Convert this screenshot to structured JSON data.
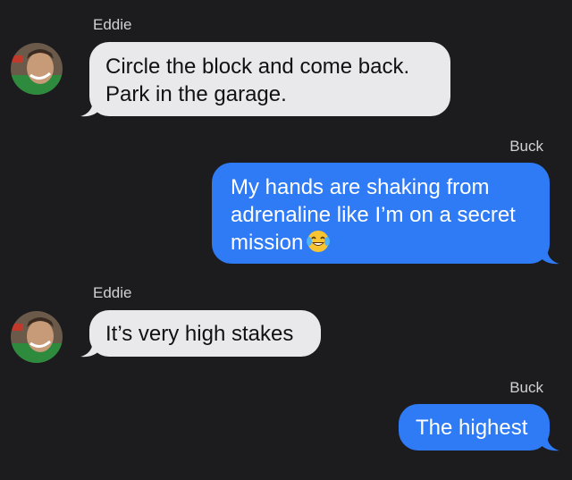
{
  "messages": [
    {
      "sender": "Eddie",
      "direction": "incoming",
      "lines": [
        "Circle the block and come back.",
        "Park in the garage."
      ]
    },
    {
      "sender": "Buck",
      "direction": "outgoing",
      "lines": [
        "My hands are shaking from",
        "adrenaline like I’m on a secret",
        "mission"
      ],
      "emoji": "tears-of-joy-emoji"
    },
    {
      "sender": "Eddie",
      "direction": "incoming",
      "lines": [
        "It’s very high stakes"
      ]
    },
    {
      "sender": "Buck",
      "direction": "outgoing",
      "lines": [
        "The highest"
      ]
    }
  ],
  "colors": {
    "background": "#1c1c1e",
    "incoming_bubble": "#e9e9eb",
    "outgoing_bubble": "#2f7bf6",
    "sender_label": "#d1d1d6"
  }
}
